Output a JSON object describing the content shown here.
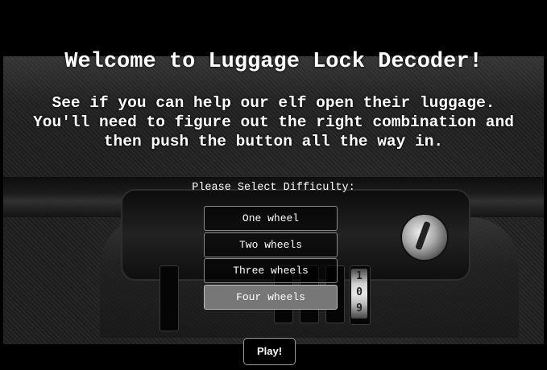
{
  "page": {
    "title": "Welcome to Luggage Lock Decoder!",
    "intro_lines": [
      "See if you can help our elf open their luggage.",
      "You'll need to figure out the right combination and",
      "then push the button all the way in."
    ]
  },
  "difficulty": {
    "label": "Please Select Difficulty:",
    "options": [
      "One wheel",
      "Two wheels",
      "Three wheels",
      "Four wheels"
    ],
    "selected": "Four wheels"
  },
  "play_button": {
    "label": "Play!"
  },
  "lock_image": {
    "wheel_digits": [
      "1",
      "0",
      "9"
    ]
  },
  "colors": {
    "background": "#000000",
    "text": "#ffffff",
    "selected_option": "#777777"
  }
}
